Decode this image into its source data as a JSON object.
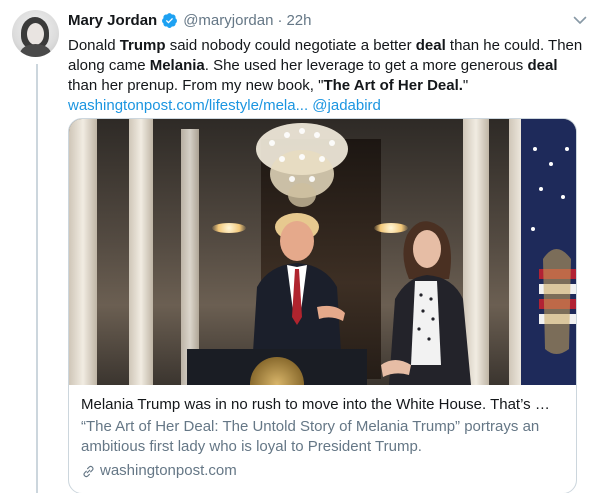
{
  "tweet": {
    "author_name": "Mary Jordan",
    "handle": "@maryjordan",
    "separator": "·",
    "timestamp": "22h",
    "text_parts": [
      {
        "t": "Donald ",
        "b": false
      },
      {
        "t": "Trump",
        "b": true
      },
      {
        "t": " said nobody could negotiate a better ",
        "b": false
      },
      {
        "t": "deal",
        "b": true
      },
      {
        "t": " than he could. Then along came ",
        "b": false
      },
      {
        "t": "Melania",
        "b": true
      },
      {
        "t": ". She used her leverage to get a more generous ",
        "b": false
      },
      {
        "t": "deal",
        "b": true
      },
      {
        "t": " than her prenup. From my new book, \"",
        "b": false
      },
      {
        "t": "The Art of Her Deal.",
        "b": true
      },
      {
        "t": "\"",
        "b": false
      }
    ],
    "link_text": "washingtonpost.com/lifestyle/mela...",
    "mention": "@jadabird",
    "icons": {
      "verified": "verified-badge-icon",
      "caret": "chevron-down-icon",
      "card_link": "link-icon"
    },
    "colors": {
      "link": "#1b95e0",
      "verified": "#1da1f2",
      "secondary_text": "#657786",
      "border": "#ccd6dd"
    }
  },
  "card": {
    "title": "Melania Trump was in no rush to move into the White House. That’s …",
    "description": "“The Art of Her Deal: The Untold Story of Melania Trump” portrays an ambitious first lady who is loyal to President Trump.",
    "domain": "washingtonpost.com"
  }
}
